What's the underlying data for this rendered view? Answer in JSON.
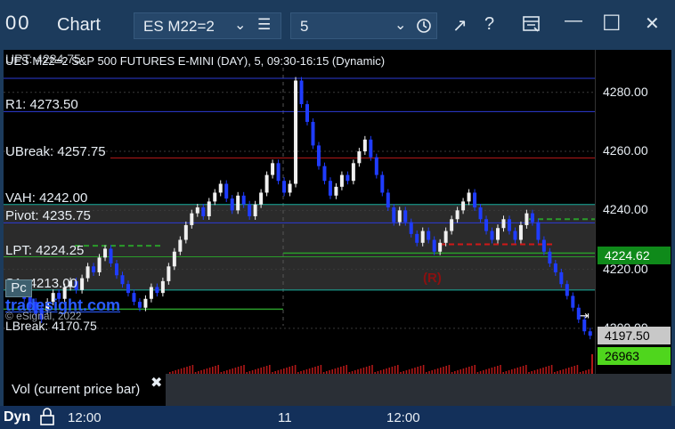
{
  "window": {
    "icon_glyph": "00",
    "title": "Chart",
    "minimize_glyph": "—",
    "maximize_glyph": "☐",
    "close_glyph": "✕",
    "help_glyph": "?",
    "pin_glyph": "↗"
  },
  "toolbar": {
    "symbol": "ES M22=2",
    "interval": "5",
    "caret": "⌄",
    "menu_glyph": "☰"
  },
  "chart": {
    "header": "UES M22=2 S&P 500 FUTURES E-MINI (DAY), 5, 09:30-16:15 (Dynamic)",
    "ghost_upt": "UPT: 4284.75",
    "ghost_lbreak": "LBreak: 4170.75",
    "levels": [
      {
        "key": "r1",
        "label": "R1: 4273.50",
        "price": 4273.5,
        "color": "#2d3bd6"
      },
      {
        "key": "ubreak",
        "label": "UBreak: 4257.75",
        "price": 4257.75,
        "color": "#b01818"
      },
      {
        "key": "vah",
        "label": "VAH: 4242.00",
        "price": 4242.0,
        "color": "#19b0a0"
      },
      {
        "key": "pivot",
        "label": "Pivot: 4235.75",
        "price": 4235.75,
        "color": "#2d3bd6"
      },
      {
        "key": "lpt",
        "label": "LPT: 4224.25",
        "price": 4224.25,
        "color": "#2a9c2a"
      },
      {
        "key": "s1",
        "label": "S1: 4213.00",
        "price": 4213.0,
        "color": "#19b0a0"
      }
    ],
    "ghost_top_level_price": 4284.75,
    "brand": "tradesight.com",
    "copyright": "© eSignal, 2022",
    "pc_button": "Pc",
    "r_marker": "(R)",
    "scroll_end_glyph": "⇥",
    "price_min": 4187,
    "price_max": 4292
  },
  "price_axis": {
    "ticks": [
      {
        "label": "4280.00",
        "price": 4280
      },
      {
        "label": "4260.00",
        "price": 4260
      },
      {
        "label": "4240.00",
        "price": 4240
      },
      {
        "label": "4220.00",
        "price": 4220
      },
      {
        "label": "4200.00",
        "price": 4200
      }
    ],
    "current_tag": {
      "label": "4224.62",
      "price": 4224.62,
      "color": "#0f8a1a"
    },
    "last_tag": {
      "label": "4197.50",
      "price": 4197.5,
      "color": "#c8c8c8"
    },
    "volume_tag": {
      "label": "26963",
      "color": "#4fd61d"
    }
  },
  "volume_pane": {
    "legend": "Vol (current price bar)",
    "close_glyph": "✖"
  },
  "time_axis": {
    "mode": "Dyn",
    "labels": [
      "12:00",
      "11",
      "12:00"
    ]
  },
  "colors": {
    "bull_bar": "#f0f0f0",
    "bear_bar": "#1f3cff",
    "volume": "#b01818",
    "accent": "#1c3b5c"
  }
}
